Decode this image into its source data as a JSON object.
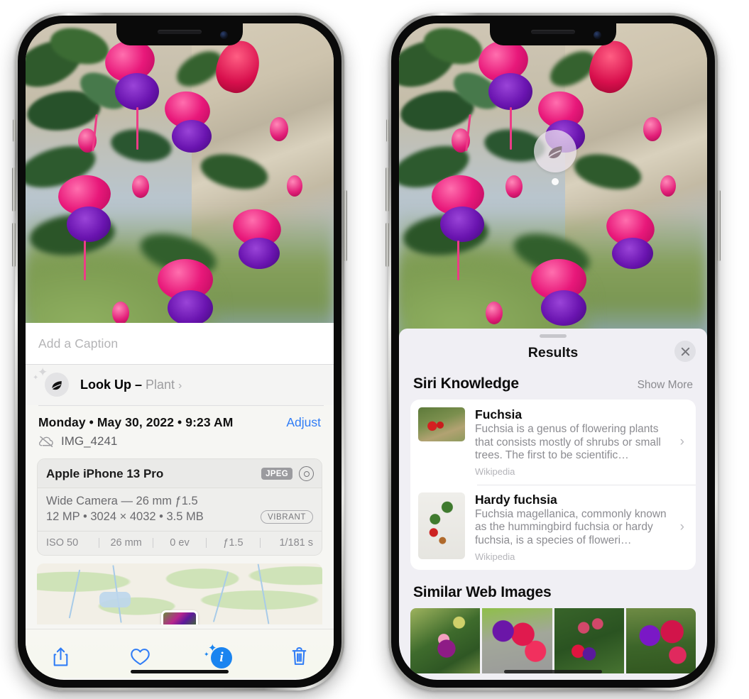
{
  "left_phone": {
    "caption_placeholder": "Add a Caption",
    "lookup": {
      "label": "Look Up – ",
      "subject": "Plant",
      "chevron": "›",
      "icon": "leaf-icon"
    },
    "meta": {
      "date": "Monday • May 30, 2022 • 9:23 AM",
      "adjust_label": "Adjust",
      "filename": "IMG_4241",
      "cloud_icon": "cloud-slash-icon"
    },
    "exif": {
      "model": "Apple iPhone 13 Pro",
      "format_chip": "JPEG",
      "lens_line": "Wide Camera — 26 mm ƒ1.5",
      "size_line": "12 MP • 3024 × 4032 • 3.5 MB",
      "style_chip": "VIBRANT",
      "stats": [
        "ISO 50",
        "26 mm",
        "0 ev",
        "ƒ1.5",
        "1/181 s"
      ]
    },
    "toolbar": {
      "share_label": "share-icon",
      "favorite_label": "heart-icon",
      "info_label": "i",
      "delete_label": "trash-icon"
    }
  },
  "right_phone": {
    "pin_icon": "leaf-icon",
    "sheet": {
      "title": "Results",
      "close_label": "×"
    },
    "siri_knowledge": {
      "title": "Siri Knowledge",
      "action": "Show More",
      "items": [
        {
          "title": "Fuchsia",
          "description": "Fuchsia is a genus of flowering plants that consists mostly of shrubs or small trees. The first to be scientific…",
          "source": "Wikipedia",
          "chevron": "›"
        },
        {
          "title": "Hardy fuchsia",
          "description": "Fuchsia magellanica, commonly known as the hummingbird fuchsia or hardy fuchsia, is a species of floweri…",
          "source": "Wikipedia",
          "chevron": "›"
        }
      ]
    },
    "similar_web_images": {
      "title": "Similar Web Images",
      "count": 4
    }
  },
  "colors": {
    "accent_blue": "#2f7cf6",
    "sheet_bg": "#f0eff4",
    "info_bg": "#f6f6f3",
    "card_white": "#ffffff",
    "secondary_text": "#8c8c91"
  }
}
